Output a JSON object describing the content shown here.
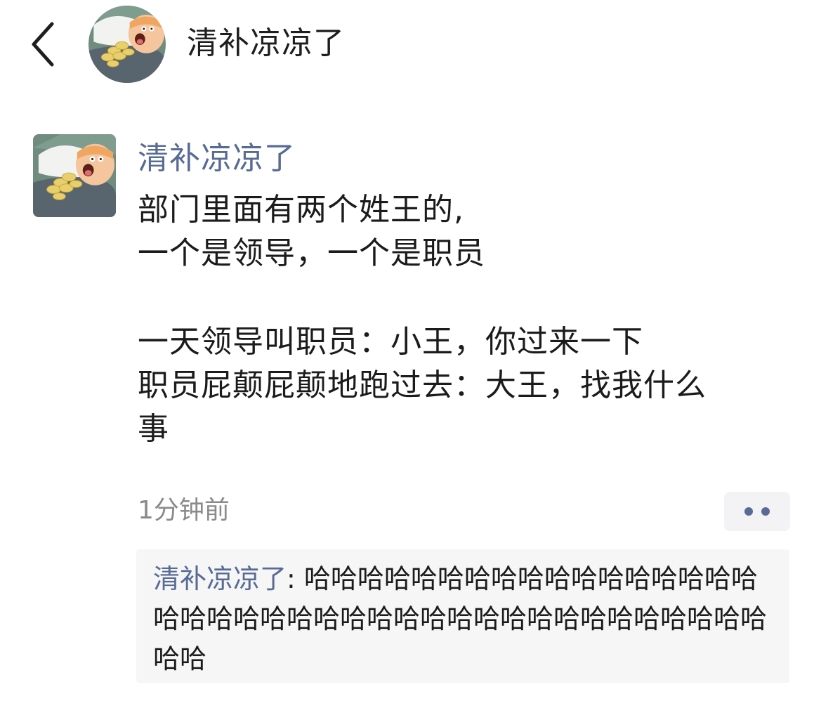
{
  "header": {
    "back_icon": "chevron-left-icon",
    "title": "清补凉凉了"
  },
  "post": {
    "author": "清补凉凉了",
    "lines": [
      "部门里面有两个姓王的,",
      "一个是领导，一个是职员",
      "",
      "一天领导叫职员：小王，你过来一下",
      "职员屁颠屁颠地跑过去：大王，找我什么",
      "事"
    ],
    "time": "1分钟前",
    "more_icon": "more-dots-icon"
  },
  "comments": [
    {
      "author": "清补凉凉了",
      "separator": ": ",
      "text": "哈哈哈哈哈哈哈哈哈哈哈哈哈哈哈哈哈哈哈哈哈哈哈哈哈哈哈哈哈哈哈哈哈哈哈哈哈哈哈哈哈哈"
    }
  ],
  "colors": {
    "link_blue": "#576b95",
    "time_gray": "#8a8a8a",
    "comment_bg": "#f6f6f6"
  }
}
